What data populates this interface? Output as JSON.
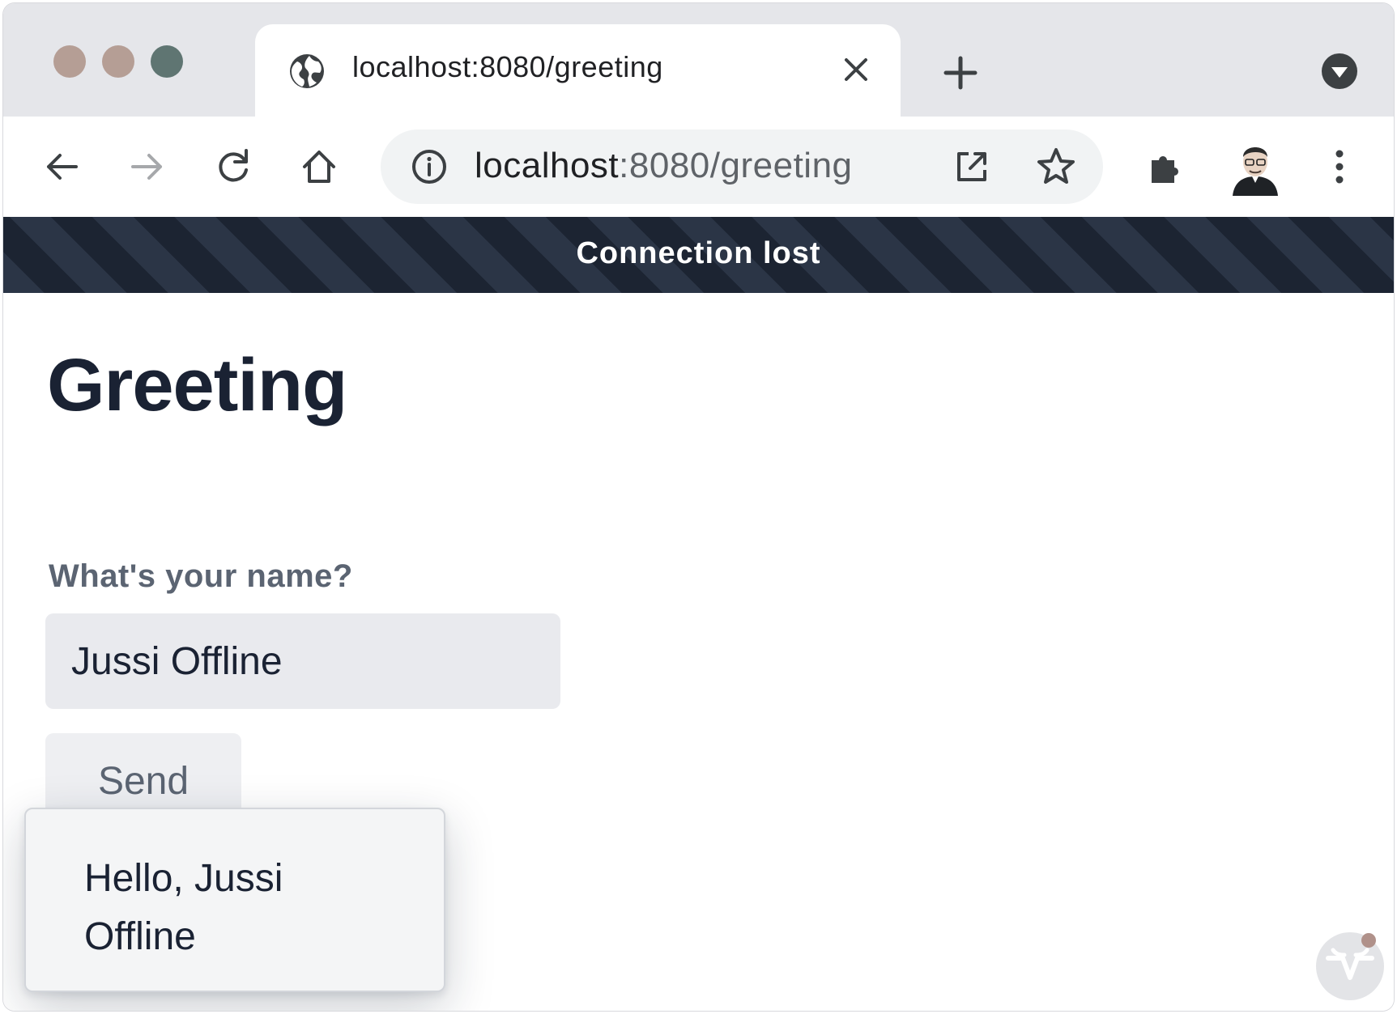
{
  "browser": {
    "window_controls": {
      "close_color": "#b59e95",
      "minimize_color": "#b59e95",
      "zoom_color": "#5f7572"
    },
    "tab": {
      "title": "localhost:8080/greeting",
      "favicon": "globe-icon"
    },
    "address_bar": {
      "url_host": "localhost",
      "url_rest": ":8080/greeting"
    }
  },
  "connection_banner": {
    "text": "Connection lost",
    "stripe_colors": [
      "#2b3546",
      "#1c2432"
    ]
  },
  "page": {
    "title": "Greeting",
    "name_field": {
      "label": "What's your name?",
      "value": "Jussi Offline"
    },
    "send_button_label": "Send",
    "notification": {
      "text": "Hello, Jussi Offline"
    }
  },
  "colors": {
    "heading": "#1a2233",
    "field_background": "#e9eaee",
    "banner_text": "#ffffff"
  }
}
